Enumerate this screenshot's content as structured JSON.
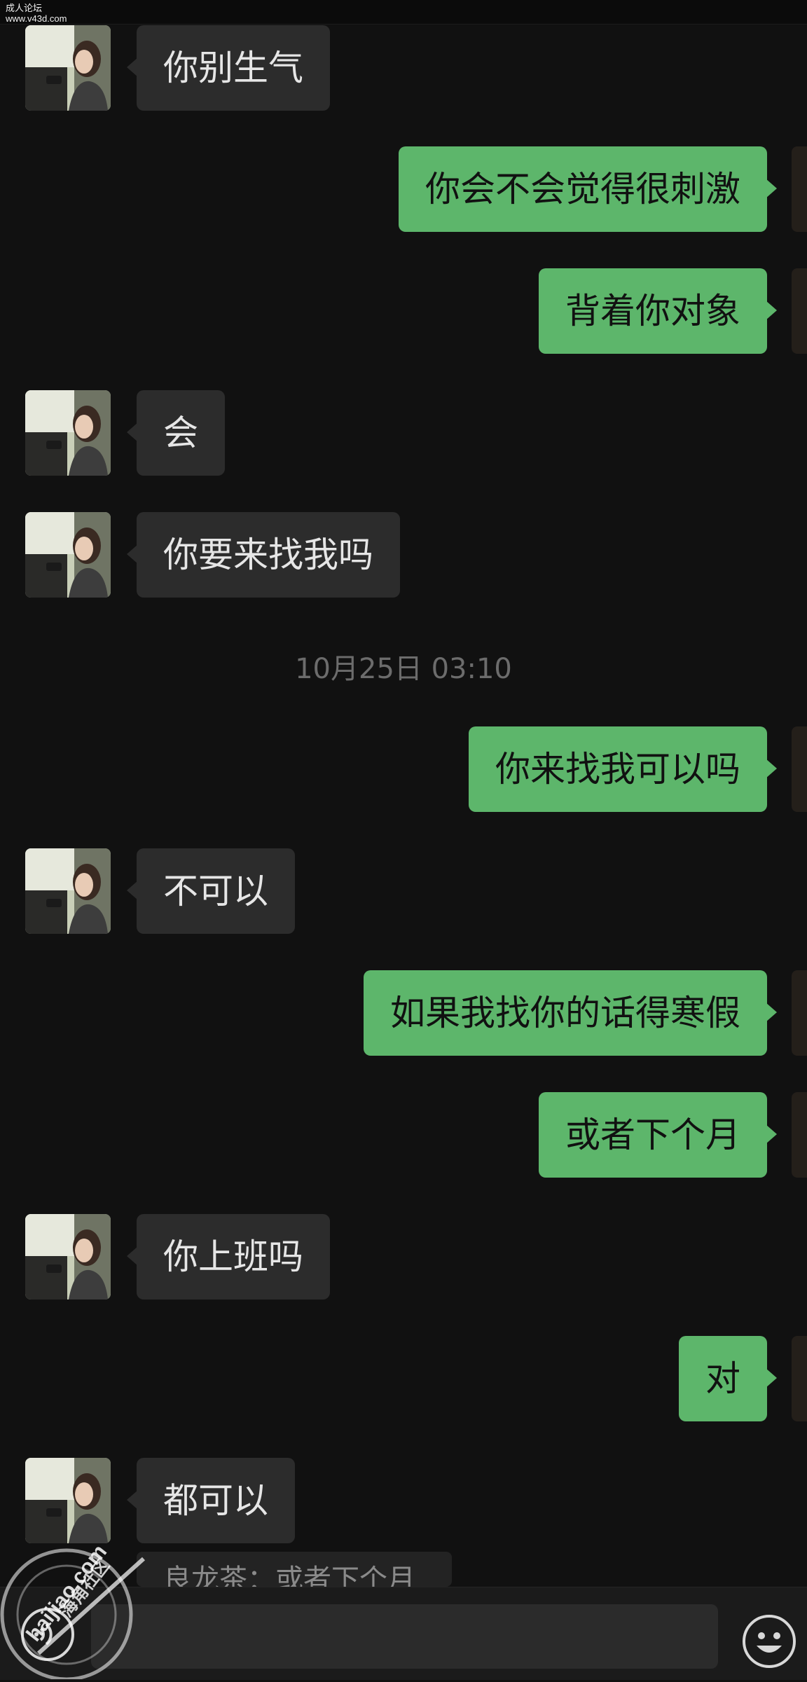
{
  "watermark_top": {
    "line1": "成人论坛",
    "line2": "www.v43d.com"
  },
  "messages": [
    {
      "side": "in",
      "text": "你别生气"
    },
    {
      "side": "out",
      "text": "你会不会觉得很刺激"
    },
    {
      "side": "out",
      "text": "背着你对象"
    },
    {
      "side": "in",
      "text": "会"
    },
    {
      "side": "in",
      "text": "你要来找我吗"
    },
    {
      "side": "out",
      "text": "你来找我可以吗"
    },
    {
      "side": "in",
      "text": "不可以"
    },
    {
      "side": "out",
      "text": "如果我找你的话得寒假"
    },
    {
      "side": "out",
      "text": "或者下个月"
    },
    {
      "side": "in",
      "text": "你上班吗"
    },
    {
      "side": "out",
      "text": "对"
    },
    {
      "side": "in",
      "text": "都可以"
    }
  ],
  "timestamp": "10月25日 03:10",
  "quote": "良龙茶：或者下个月",
  "watermark_bottom": {
    "site": "haijiao.com",
    "name": "海角社区"
  },
  "icons": {
    "voice": "voice-icon",
    "emoji": "emoji-icon"
  },
  "colors": {
    "background": "#111111",
    "incoming_bubble": "#2c2c2c",
    "outgoing_bubble": "#5db66b",
    "timestamp": "#6c6c6c"
  }
}
